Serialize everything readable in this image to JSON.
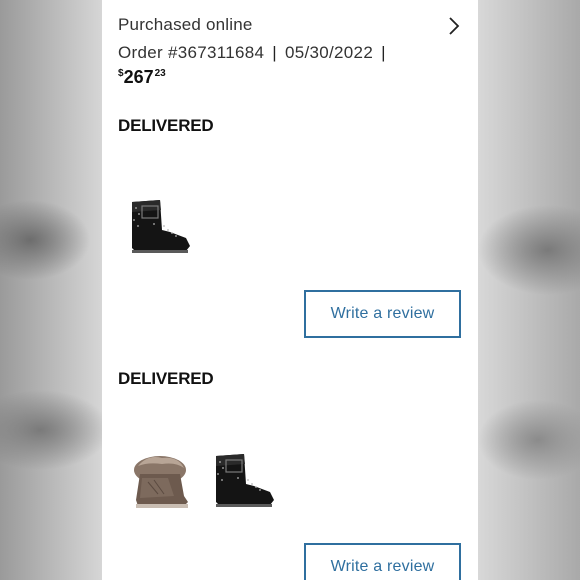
{
  "order": {
    "channel": "Purchased online",
    "order_number": "Order #367311684",
    "date": "05/30/2022",
    "price_currency": "$",
    "price_dollars": "267",
    "price_cents": "23"
  },
  "shipments": [
    {
      "status": "DELIVERED",
      "items": [
        {
          "icon": "black-boot-image"
        }
      ],
      "review_label": "Write a review"
    },
    {
      "status": "DELIVERED",
      "items": [
        {
          "icon": "fur-boot-image"
        },
        {
          "icon": "black-boot-image"
        }
      ],
      "review_label": "Write a review"
    }
  ],
  "colors": {
    "link_blue": "#2f6f9f",
    "text_dark": "#333333"
  }
}
